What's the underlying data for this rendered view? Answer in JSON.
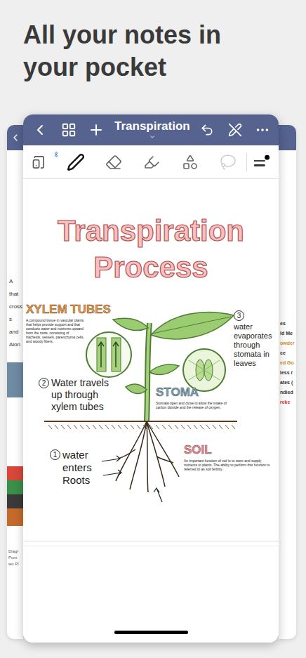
{
  "heading": "All your notes in your pocket",
  "nav": {
    "title": "Transpiration"
  },
  "toolbar": {
    "tools": [
      {
        "kind": "pen",
        "selected": true,
        "disabled": false
      },
      {
        "kind": "eraser",
        "selected": false,
        "disabled": false
      },
      {
        "kind": "highlighter",
        "selected": false,
        "disabled": false
      },
      {
        "kind": "shapes",
        "selected": false,
        "disabled": false
      },
      {
        "kind": "lasso",
        "selected": false,
        "disabled": true
      }
    ]
  },
  "note": {
    "title": "Transpiration Process",
    "annotations": [
      {
        "kind": "heading",
        "text": "XYLEM TUBES",
        "color": "#e39a4a",
        "description": "A compound tissue in vascular plants that helps provide support and that conducts water and nutrients upward from the roots, consisting of tracheids, vessels, parenchyma cells, and woody fibers."
      },
      {
        "kind": "step",
        "number": "3",
        "text": "water evaporates through stomata in leaves"
      },
      {
        "kind": "step",
        "number": "2",
        "text": "Water travels up through xylem tubes"
      },
      {
        "kind": "heading",
        "text": "STOMA",
        "color": "#5fa8cf",
        "description": "Stomata open and close to allow the intake of carbon dioxide and the release of oxygen."
      },
      {
        "kind": "step",
        "number": "1",
        "text": "water enters Roots"
      },
      {
        "kind": "heading",
        "text": "SOIL",
        "color": "#e98aa6",
        "description": "An important function of soil is to store and supply nutrients to plants. The ability to perform this function is referred to as soil fertility."
      }
    ]
  },
  "left_card": {
    "fragments": [
      "A",
      "that",
      "cross",
      "s",
      "and",
      "Alon"
    ],
    "footer": [
      "Diagr",
      "Pum",
      "wo Pl"
    ]
  },
  "right_card": {
    "fragments": [
      {
        "text": "es",
        "color": "#333333"
      },
      {
        "text": "ld Me",
        "color": "#333333"
      },
      {
        "text": "owder",
        "color": "#e08a2a"
      },
      {
        "text": "ce",
        "color": "#333333"
      },
      {
        "text": "ed Go",
        "color": "#c98a1a"
      },
      {
        "text": "less r",
        "color": "#333333"
      },
      {
        "text": "ates (",
        "color": "#333333"
      },
      {
        "text": "ndied",
        "color": "#333333"
      },
      {
        "text": "reke",
        "color": "#d9342b"
      }
    ]
  }
}
